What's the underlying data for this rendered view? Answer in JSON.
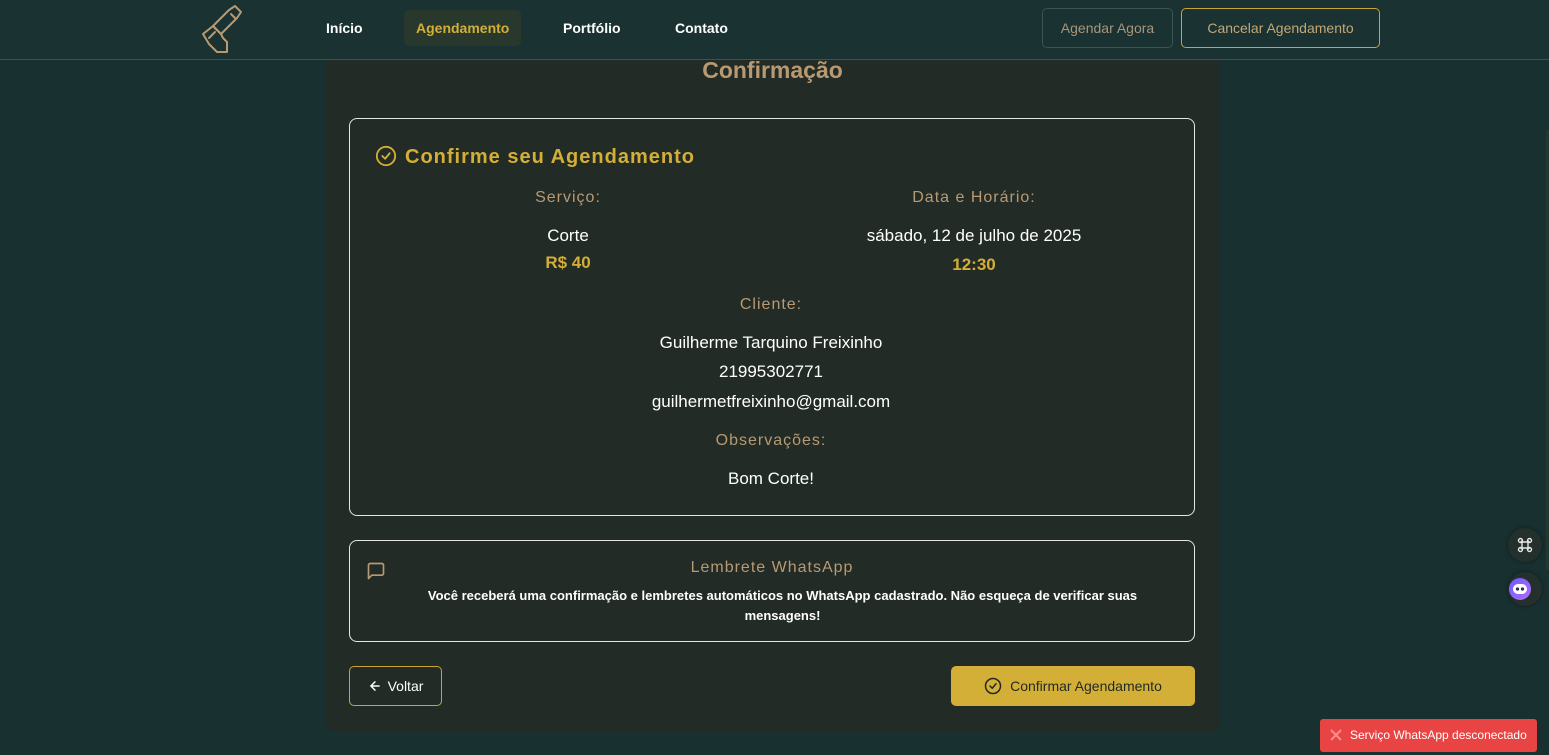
{
  "nav": {
    "items": [
      {
        "label": "Início",
        "active": false
      },
      {
        "label": "Agendamento",
        "active": true
      },
      {
        "label": "Portfólio",
        "active": false
      },
      {
        "label": "Contato",
        "active": false
      }
    ],
    "agendar_label": "Agendar Agora",
    "cancelar_label": "Cancelar Agendamento"
  },
  "step": {
    "title": "Confirmação"
  },
  "confirm": {
    "heading": "Confirme seu Agendamento",
    "service_label": "Serviço:",
    "service_name": "Corte",
    "service_price": "R$ 40",
    "datetime_label": "Data e Horário:",
    "date": "sábado, 12 de julho de 2025",
    "time": "12:30",
    "client_label": "Cliente:",
    "client_name": "Guilherme Tarquino Freixinho",
    "client_phone": "21995302771",
    "client_email": "guilhermetfreixinho@gmail.com",
    "notes_label": "Observações:",
    "notes": "Bom Corte!"
  },
  "whatsapp": {
    "title": "Lembrete WhatsApp",
    "text": "Você receberá uma confirmação e lembretes automáticos no WhatsApp cadastrado. Não esqueça de verificar suas mensagens!"
  },
  "actions": {
    "back_label": "Voltar",
    "confirm_label": "Confirmar Agendamento"
  },
  "toast": {
    "text": "Serviço WhatsApp desconectado"
  },
  "colors": {
    "background": "#183030",
    "panel": "#222b26",
    "accent_gold": "#d4af37",
    "label_tan": "#b89a72",
    "toast_red": "#e94444"
  },
  "icons": {
    "logo": "razor-hand-logo",
    "heading": "check-circle-icon",
    "whatsapp": "message-square-icon",
    "back": "arrow-left-icon",
    "confirm": "check-circle-icon",
    "float1": "command-icon",
    "float2": "bot-face-icon",
    "toast": "close-x-icon"
  }
}
